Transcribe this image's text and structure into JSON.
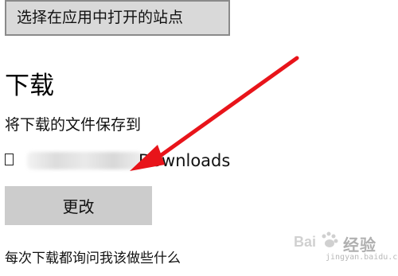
{
  "top_button": {
    "label": "选择在应用中打开的站点"
  },
  "downloads": {
    "title": "下载",
    "subtitle": "将下载的文件保存到",
    "path_suffix": "Downloads",
    "change_label": "更改",
    "ask_label": "每次下载都询问我该做些什么"
  },
  "watermark": {
    "logo_text": "Bai",
    "text": "经验",
    "url": "jingyan.baidu.com"
  },
  "colors": {
    "arrow": "#e8141a",
    "button_bg": "#cccccc",
    "top_button_bg": "#d9d9d9"
  }
}
